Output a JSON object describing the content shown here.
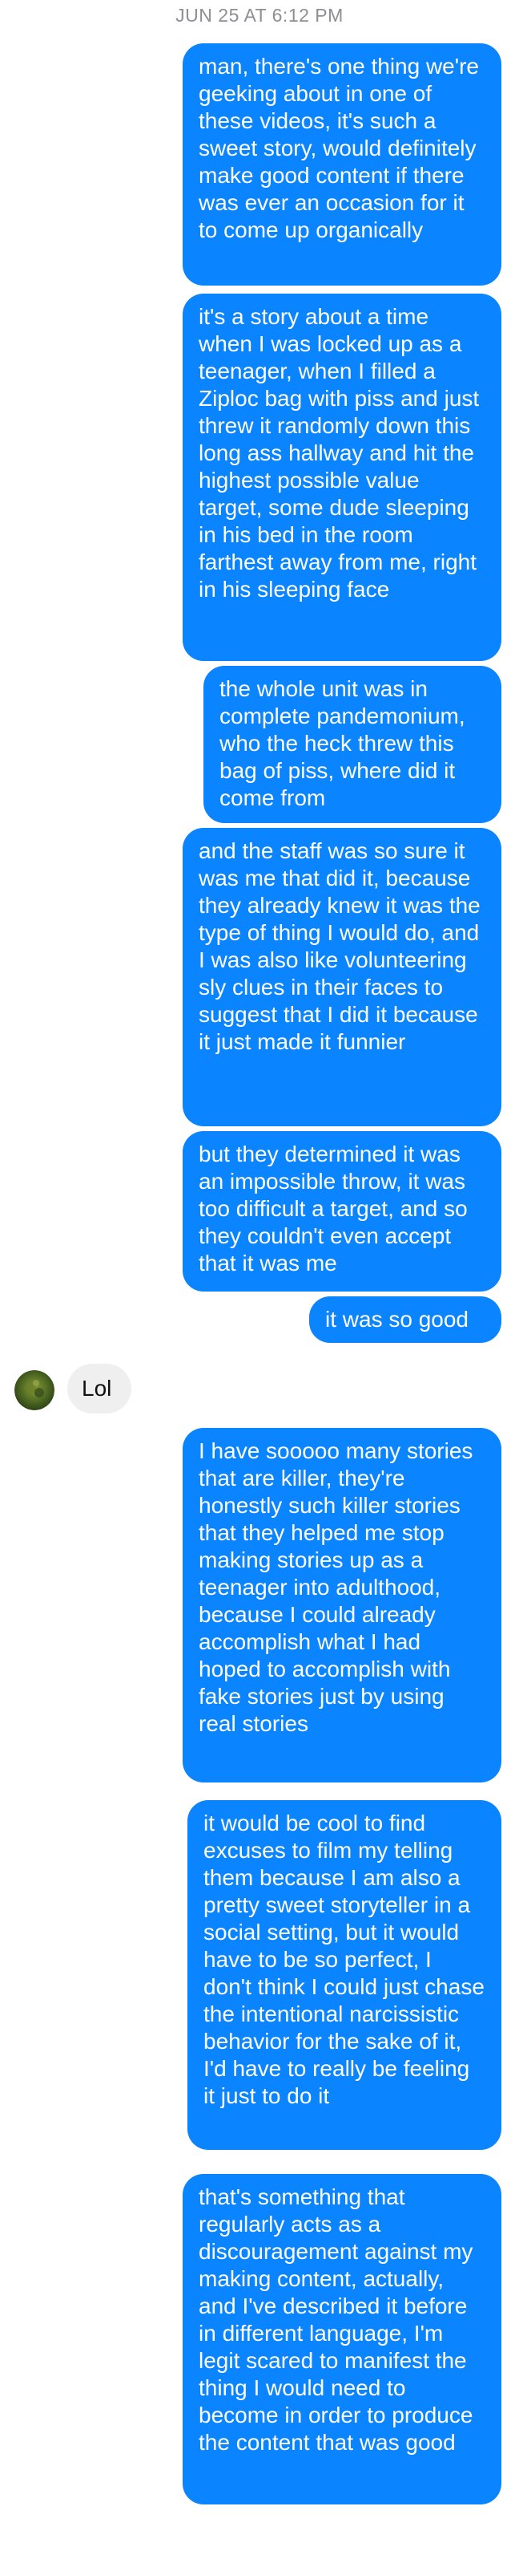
{
  "timestamp": "JUN 25 AT 6:12 PM",
  "messages": [
    {
      "text": "man, there's one thing we're geeking about in one of these videos, it's such a sweet story, would definitely make good content if there was ever an occasion for it to come up organically"
    },
    {
      "text": "it's a story about a time when I was locked up as a teenager, when I filled a Ziploc bag with piss and just threw it randomly down this long ass hallway and hit the highest possible value target, some dude sleeping in his bed in the room farthest away from me, right in his sleeping face"
    },
    {
      "text": "the whole unit was in complete pandemonium, who the heck threw this bag of piss, where did it come from"
    },
    {
      "text": "and the staff was so sure it was me that did it, because they already knew it was the type of thing I would do, and I was also like volunteering sly clues in their faces to suggest that I did it because it just made it funnier"
    },
    {
      "text": "but they determined it was an impossible throw, it was too difficult a target, and so they couldn't even accept that it was me"
    },
    {
      "text": "it was so good"
    },
    {
      "text": "Lol"
    },
    {
      "text": "I have sooooo many stories that are killer, they're honestly such killer stories that they helped me stop making stories up as a teenager into adulthood, because I could already accomplish what I had hoped to accomplish with fake stories just by using real stories"
    },
    {
      "text": "it would be cool to find excuses to film my telling them because I am also a pretty sweet storyteller in a social setting, but it would have to be so perfect, I don't think I could just chase the intentional narcissistic behavior for the sake of it, I'd have to really be feeling it just to do it"
    },
    {
      "text": "that's something that regularly acts as a discouragement against my making content, actually, and I've described it before in different language, I'm legit scared to manifest the thing I would need to become in order to produce the content that was good"
    }
  ],
  "colors": {
    "outgoing": "#0a84ff",
    "incoming": "#efefef"
  },
  "icons": {
    "avatar": "contact-avatar-photo"
  }
}
